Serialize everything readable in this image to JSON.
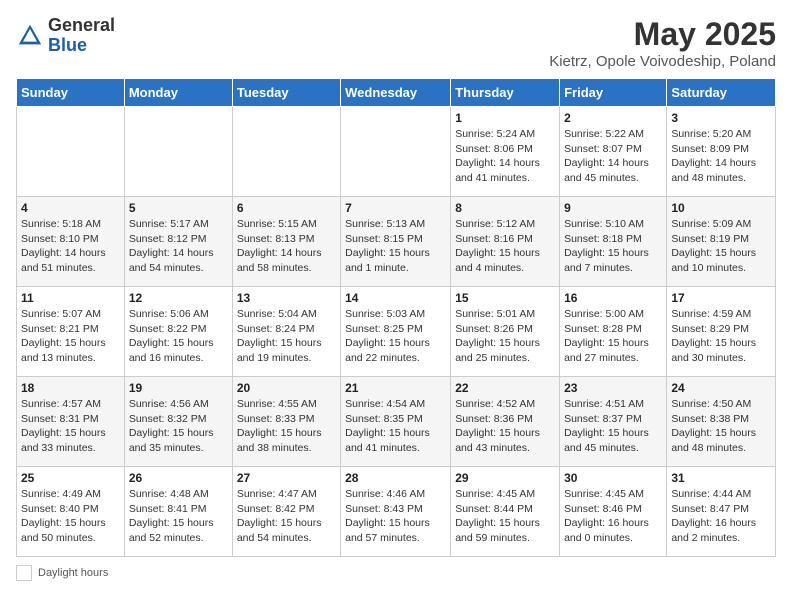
{
  "logo": {
    "general": "General",
    "blue": "Blue"
  },
  "title": "May 2025",
  "subtitle": "Kietrz, Opole Voivodeship, Poland",
  "days_of_week": [
    "Sunday",
    "Monday",
    "Tuesday",
    "Wednesday",
    "Thursday",
    "Friday",
    "Saturday"
  ],
  "weeks": [
    [
      {
        "day": "",
        "info": ""
      },
      {
        "day": "",
        "info": ""
      },
      {
        "day": "",
        "info": ""
      },
      {
        "day": "",
        "info": ""
      },
      {
        "day": "1",
        "info": "Sunrise: 5:24 AM\nSunset: 8:06 PM\nDaylight: 14 hours and 41 minutes."
      },
      {
        "day": "2",
        "info": "Sunrise: 5:22 AM\nSunset: 8:07 PM\nDaylight: 14 hours and 45 minutes."
      },
      {
        "day": "3",
        "info": "Sunrise: 5:20 AM\nSunset: 8:09 PM\nDaylight: 14 hours and 48 minutes."
      }
    ],
    [
      {
        "day": "4",
        "info": "Sunrise: 5:18 AM\nSunset: 8:10 PM\nDaylight: 14 hours and 51 minutes."
      },
      {
        "day": "5",
        "info": "Sunrise: 5:17 AM\nSunset: 8:12 PM\nDaylight: 14 hours and 54 minutes."
      },
      {
        "day": "6",
        "info": "Sunrise: 5:15 AM\nSunset: 8:13 PM\nDaylight: 14 hours and 58 minutes."
      },
      {
        "day": "7",
        "info": "Sunrise: 5:13 AM\nSunset: 8:15 PM\nDaylight: 15 hours and 1 minute."
      },
      {
        "day": "8",
        "info": "Sunrise: 5:12 AM\nSunset: 8:16 PM\nDaylight: 15 hours and 4 minutes."
      },
      {
        "day": "9",
        "info": "Sunrise: 5:10 AM\nSunset: 8:18 PM\nDaylight: 15 hours and 7 minutes."
      },
      {
        "day": "10",
        "info": "Sunrise: 5:09 AM\nSunset: 8:19 PM\nDaylight: 15 hours and 10 minutes."
      }
    ],
    [
      {
        "day": "11",
        "info": "Sunrise: 5:07 AM\nSunset: 8:21 PM\nDaylight: 15 hours and 13 minutes."
      },
      {
        "day": "12",
        "info": "Sunrise: 5:06 AM\nSunset: 8:22 PM\nDaylight: 15 hours and 16 minutes."
      },
      {
        "day": "13",
        "info": "Sunrise: 5:04 AM\nSunset: 8:24 PM\nDaylight: 15 hours and 19 minutes."
      },
      {
        "day": "14",
        "info": "Sunrise: 5:03 AM\nSunset: 8:25 PM\nDaylight: 15 hours and 22 minutes."
      },
      {
        "day": "15",
        "info": "Sunrise: 5:01 AM\nSunset: 8:26 PM\nDaylight: 15 hours and 25 minutes."
      },
      {
        "day": "16",
        "info": "Sunrise: 5:00 AM\nSunset: 8:28 PM\nDaylight: 15 hours and 27 minutes."
      },
      {
        "day": "17",
        "info": "Sunrise: 4:59 AM\nSunset: 8:29 PM\nDaylight: 15 hours and 30 minutes."
      }
    ],
    [
      {
        "day": "18",
        "info": "Sunrise: 4:57 AM\nSunset: 8:31 PM\nDaylight: 15 hours and 33 minutes."
      },
      {
        "day": "19",
        "info": "Sunrise: 4:56 AM\nSunset: 8:32 PM\nDaylight: 15 hours and 35 minutes."
      },
      {
        "day": "20",
        "info": "Sunrise: 4:55 AM\nSunset: 8:33 PM\nDaylight: 15 hours and 38 minutes."
      },
      {
        "day": "21",
        "info": "Sunrise: 4:54 AM\nSunset: 8:35 PM\nDaylight: 15 hours and 41 minutes."
      },
      {
        "day": "22",
        "info": "Sunrise: 4:52 AM\nSunset: 8:36 PM\nDaylight: 15 hours and 43 minutes."
      },
      {
        "day": "23",
        "info": "Sunrise: 4:51 AM\nSunset: 8:37 PM\nDaylight: 15 hours and 45 minutes."
      },
      {
        "day": "24",
        "info": "Sunrise: 4:50 AM\nSunset: 8:38 PM\nDaylight: 15 hours and 48 minutes."
      }
    ],
    [
      {
        "day": "25",
        "info": "Sunrise: 4:49 AM\nSunset: 8:40 PM\nDaylight: 15 hours and 50 minutes."
      },
      {
        "day": "26",
        "info": "Sunrise: 4:48 AM\nSunset: 8:41 PM\nDaylight: 15 hours and 52 minutes."
      },
      {
        "day": "27",
        "info": "Sunrise: 4:47 AM\nSunset: 8:42 PM\nDaylight: 15 hours and 54 minutes."
      },
      {
        "day": "28",
        "info": "Sunrise: 4:46 AM\nSunset: 8:43 PM\nDaylight: 15 hours and 57 minutes."
      },
      {
        "day": "29",
        "info": "Sunrise: 4:45 AM\nSunset: 8:44 PM\nDaylight: 15 hours and 59 minutes."
      },
      {
        "day": "30",
        "info": "Sunrise: 4:45 AM\nSunset: 8:46 PM\nDaylight: 16 hours and 0 minutes."
      },
      {
        "day": "31",
        "info": "Sunrise: 4:44 AM\nSunset: 8:47 PM\nDaylight: 16 hours and 2 minutes."
      }
    ]
  ],
  "footer": {
    "daylight_label": "Daylight hours"
  }
}
